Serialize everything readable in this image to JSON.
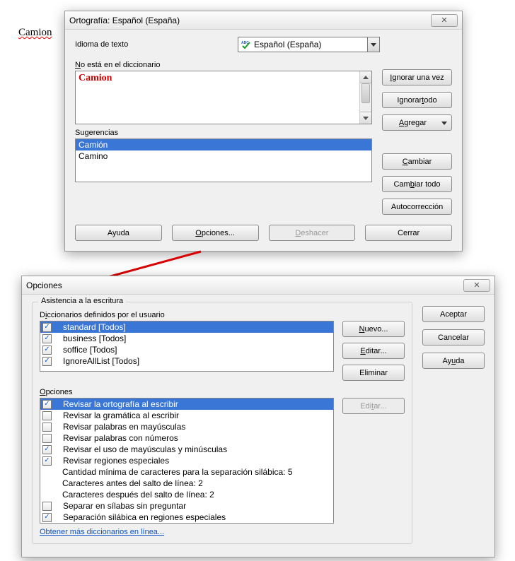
{
  "document": {
    "misspelled": "Camion"
  },
  "spell_dialog": {
    "title": "Ortografía: Español (España)",
    "lang_label": "Idioma de texto",
    "lang_value": "Español (España)",
    "not_in_dict_label": "No está en el diccionario",
    "not_in_dict_text": "Camion",
    "suggestions_label": "Sugerencias",
    "suggestions": [
      "Camión",
      "Camino"
    ],
    "btn_ignore_once": "Ignorar una vez",
    "btn_ignore_all": "Ignorar todo",
    "btn_add": "Agregar",
    "btn_change": "Cambiar",
    "btn_change_all": "Cambiar todo",
    "btn_autocorrect": "Autocorrección",
    "btn_help": "Ayuda",
    "btn_options": "Opciones...",
    "btn_undo": "Deshacer",
    "btn_close": "Cerrar"
  },
  "options_dialog": {
    "title": "Opciones",
    "group_title": "Asistencia a la escritura",
    "dicts_label": "Diccionarios definidos por el usuario",
    "dicts": [
      {
        "label": "standard [Todos]",
        "checked": true,
        "selected": true
      },
      {
        "label": "business [Todos]",
        "checked": true,
        "selected": false
      },
      {
        "label": "soffice [Todos]",
        "checked": true,
        "selected": false
      },
      {
        "label": "IgnoreAllList [Todos]",
        "checked": true,
        "selected": false
      }
    ],
    "btn_new": "Nuevo...",
    "btn_edit": "Editar...",
    "btn_delete": "Eliminar",
    "options_label": "Opciones",
    "options": [
      {
        "label": "Revisar la ortografía al escribir",
        "checked": true,
        "selected": true
      },
      {
        "label": "Revisar la gramática al escribir",
        "checked": false,
        "selected": false
      },
      {
        "label": "Revisar palabras en mayúsculas",
        "checked": false,
        "selected": false
      },
      {
        "label": "Revisar palabras con números",
        "checked": false,
        "selected": false
      },
      {
        "label": "Revisar el uso de mayúsculas y minúsculas",
        "checked": true,
        "selected": false
      },
      {
        "label": "Revisar regiones especiales",
        "checked": true,
        "selected": false
      },
      {
        "label": "Cantidad mínima de caracteres para la separación silábica:  5",
        "checked": null,
        "selected": false
      },
      {
        "label": "Caracteres antes del salto de línea: 2",
        "checked": null,
        "selected": false
      },
      {
        "label": "Caracteres después del salto de línea: 2",
        "checked": null,
        "selected": false
      },
      {
        "label": "Separar en sílabas sin preguntar",
        "checked": false,
        "selected": false
      },
      {
        "label": "Separación silábica en regiones especiales",
        "checked": true,
        "selected": false
      }
    ],
    "btn_opts_edit": "Editar...",
    "link": "Obtener más diccionarios en línea...",
    "btn_ok": "Aceptar",
    "btn_cancel": "Cancelar",
    "btn_help": "Ayuda"
  }
}
